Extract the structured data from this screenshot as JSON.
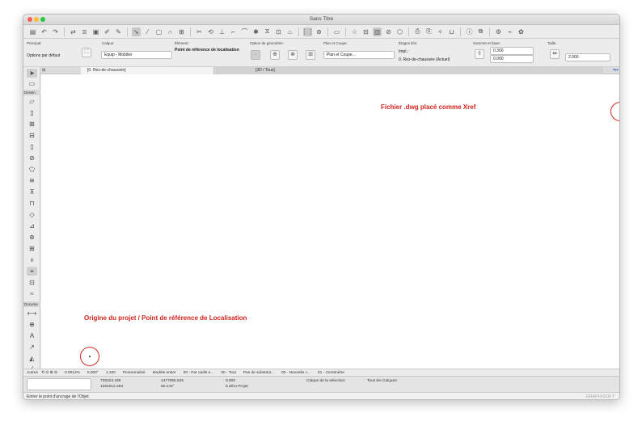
{
  "window": {
    "title": "Sans Titre"
  },
  "infobox": {
    "principal_label": "Principal:",
    "principal_value": "Options par défaut",
    "calque_label": "Calque:",
    "calque_value": "Equip - Mobilier",
    "element_label": "Élément:",
    "element_value": "Point de référence de localisation",
    "geometry_label": "Option de géométrie:",
    "plan_label": "Plan et Coupe:",
    "plan_value": "Plan et Coupe...",
    "etages_label": "Étages liés:",
    "etages_impl": "Impl.:",
    "etages_value": "0. Rez-de-chaussée (Actuel)",
    "sommet_label": "Sommet et base:",
    "sommet_top": "0.300",
    "sommet_base": "0.000",
    "taille_label": "Taille:",
    "taille_value": "2.000"
  },
  "tabs": [
    {
      "label": "[0. Rez-de-chaussée]"
    },
    {
      "label": "[3D / Tous]"
    }
  ],
  "toolbox": {
    "header_dessin": "Dessin",
    "header_docume": "Docume",
    "header_autres": "Autres"
  },
  "canvas": {
    "xref_label": "Fichier .dwg placé comme Xref",
    "origin_label": "Origine du projet / Point de référence de Localisation"
  },
  "statusbar": {
    "zoom": "0.0012%",
    "angle": "0.000°",
    "scale": "1:100",
    "struct": "Personnalisé",
    "model": "Modèle entier",
    "layers": "00 - Par outils e...",
    "pen": "00 - Tout",
    "subst": "Pas de substitut...",
    "reno": "00 - Nouvelle c...",
    "dim": "01 - Centimètre"
  },
  "coords": {
    "dx": "735323.436",
    "dy": "1281012.283",
    "dr": "1477055.525",
    "da": "60.143°",
    "dz": "0.000",
    "z_ref": "à Zéro Projet",
    "layer_sel": "Calque de la sélection:",
    "all_layers": "Tous les Calques:"
  },
  "status": {
    "message": "Entrer le point d'ancrage de l'Objet.",
    "brand": "GRAPHISOFT"
  },
  "colors": {
    "annotation": "#d0241c"
  }
}
